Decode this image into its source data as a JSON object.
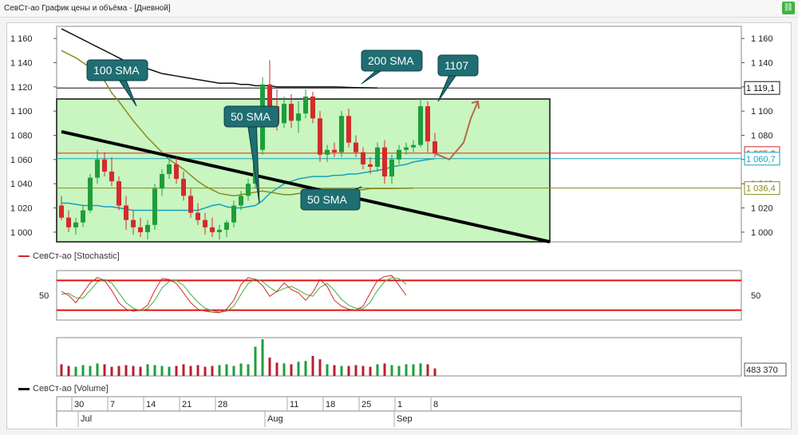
{
  "window": {
    "title": "СевСт-ао График цены и объёма - [Дневной]",
    "link_icon": "link-icon"
  },
  "colors": {
    "bull": "#1e9e3a",
    "bear": "#d42a2a",
    "sma50": "#15a0c0",
    "sma100": "#8a8a1a",
    "sma200": "#111111",
    "channel": "#c8f5c0",
    "callout": "#1f6e73",
    "stoch_k": "#d42a2a",
    "stoch_d": "#40b040",
    "stoch_level": "#e01010",
    "volume_up": "#1e9e3a",
    "volume_down": "#b81e2e"
  },
  "price_panel": {
    "y_ticks": [
      "1 160",
      "1 140",
      "1 120",
      "1 100",
      "1 080",
      "1 060",
      "1 040",
      "1 020",
      "1 000"
    ],
    "tags": [
      {
        "label": "1 119,1",
        "value": 1119.1,
        "color": "#111111"
      },
      {
        "label": "1 065,3",
        "value": 1065.3,
        "color": "#d42a2a"
      },
      {
        "label": "1 060,7",
        "value": 1060.7,
        "color": "#15a0c0"
      },
      {
        "label": "1 036,4",
        "value": 1036.4,
        "color": "#8a8a1a"
      }
    ],
    "callouts": [
      {
        "label": "100 SMA"
      },
      {
        "label": "50 SMA"
      },
      {
        "label": "200 SMA"
      },
      {
        "label": "1107"
      },
      {
        "label": "50 SMA"
      }
    ]
  },
  "stochastic": {
    "legend": "СевСт-ао [Stochastic]",
    "tick": "50",
    "upper": 80,
    "lower": 20
  },
  "volume": {
    "legend": "СевСт-ао [Volume]",
    "last_label": "483 370"
  },
  "time_axis": {
    "days": [
      {
        "label": "30",
        "idx": 2
      },
      {
        "label": "7",
        "idx": 7
      },
      {
        "label": "14",
        "idx": 12
      },
      {
        "label": "21",
        "idx": 17
      },
      {
        "label": "28",
        "idx": 22
      },
      {
        "label": "11",
        "idx": 32
      },
      {
        "label": "18",
        "idx": 37
      },
      {
        "label": "25",
        "idx": 42
      },
      {
        "label": "1",
        "idx": 47
      },
      {
        "label": "8",
        "idx": 52
      }
    ],
    "months": [
      {
        "label": "Jul",
        "idx": 3
      },
      {
        "label": "Aug",
        "idx": 29
      },
      {
        "label": "Sep",
        "idx": 47
      }
    ]
  },
  "chart_data": {
    "type": "candlestick",
    "ylim": [
      992,
      1170
    ],
    "candles": [
      [
        1022,
        1030,
        1010,
        1012
      ],
      [
        1012,
        1018,
        1000,
        1004
      ],
      [
        1004,
        1012,
        998,
        1008
      ],
      [
        1008,
        1022,
        1004,
        1018
      ],
      [
        1018,
        1048,
        1016,
        1045
      ],
      [
        1045,
        1068,
        1040,
        1060
      ],
      [
        1060,
        1066,
        1046,
        1050
      ],
      [
        1050,
        1062,
        1038,
        1042
      ],
      [
        1042,
        1046,
        1018,
        1022
      ],
      [
        1022,
        1030,
        1002,
        1010
      ],
      [
        1010,
        1018,
        998,
        1004
      ],
      [
        1004,
        1012,
        996,
        1000
      ],
      [
        1000,
        1010,
        994,
        1006
      ],
      [
        1006,
        1040,
        1002,
        1036
      ],
      [
        1036,
        1052,
        1030,
        1048
      ],
      [
        1048,
        1060,
        1044,
        1056
      ],
      [
        1056,
        1062,
        1040,
        1044
      ],
      [
        1044,
        1050,
        1026,
        1030
      ],
      [
        1030,
        1036,
        1012,
        1016
      ],
      [
        1016,
        1024,
        1006,
        1010
      ],
      [
        1010,
        1016,
        998,
        1004
      ],
      [
        1004,
        1012,
        996,
        1000
      ],
      [
        1000,
        1006,
        994,
        1002
      ],
      [
        1002,
        1010,
        996,
        1008
      ],
      [
        1008,
        1026,
        1004,
        1022
      ],
      [
        1022,
        1034,
        1018,
        1030
      ],
      [
        1030,
        1044,
        1026,
        1040
      ],
      [
        1040,
        1072,
        1036,
        1068
      ],
      [
        1068,
        1128,
        1064,
        1122
      ],
      [
        1122,
        1142,
        1096,
        1104
      ],
      [
        1104,
        1118,
        1084,
        1090
      ],
      [
        1090,
        1112,
        1086,
        1106
      ],
      [
        1106,
        1114,
        1086,
        1092
      ],
      [
        1092,
        1108,
        1082,
        1098
      ],
      [
        1098,
        1118,
        1094,
        1112
      ],
      [
        1112,
        1116,
        1090,
        1094
      ],
      [
        1094,
        1100,
        1058,
        1064
      ],
      [
        1064,
        1072,
        1058,
        1068
      ],
      [
        1068,
        1074,
        1062,
        1066
      ],
      [
        1066,
        1100,
        1062,
        1096
      ],
      [
        1096,
        1102,
        1070,
        1074
      ],
      [
        1074,
        1080,
        1062,
        1066
      ],
      [
        1066,
        1070,
        1052,
        1056
      ],
      [
        1056,
        1062,
        1048,
        1054
      ],
      [
        1054,
        1074,
        1050,
        1070
      ],
      [
        1070,
        1076,
        1040,
        1046
      ],
      [
        1046,
        1064,
        1040,
        1060
      ],
      [
        1060,
        1072,
        1056,
        1068
      ],
      [
        1068,
        1074,
        1064,
        1070
      ],
      [
        1070,
        1076,
        1066,
        1072
      ],
      [
        1072,
        1110,
        1070,
        1104
      ],
      [
        1104,
        1108,
        1066,
        1075
      ],
      [
        1075,
        1082,
        1062,
        1065
      ]
    ],
    "sma50": [
      1024,
      1024,
      1023,
      1022,
      1022,
      1022,
      1021,
      1021,
      1020,
      1019,
      1018,
      1018,
      1018,
      1018,
      1018,
      1018,
      1018,
      1018,
      1018,
      1018,
      1020,
      1022,
      1023,
      1021,
      1020,
      1020,
      1021,
      1022,
      1026,
      1032,
      1036,
      1040,
      1042,
      1044,
      1045,
      1046,
      1046,
      1046,
      1047,
      1047,
      1048,
      1048,
      1049,
      1050,
      1051,
      1052,
      1054,
      1055,
      1056,
      1058,
      1059,
      1060,
      1060.7
    ],
    "sma100": [
      1150,
      1147,
      1144,
      1140,
      1136,
      1132,
      1125,
      1115,
      1108,
      1100,
      1092,
      1085,
      1078,
      1072,
      1066,
      1060,
      1056,
      1052,
      1047,
      1042,
      1038,
      1035,
      1032,
      1031,
      1030,
      1031,
      1032,
      1033,
      1034,
      1033,
      1032,
      1031,
      1031,
      1032,
      1032,
      1033,
      1033,
      1034,
      1034,
      1034,
      1035,
      1035,
      1035,
      1036,
      1036,
      1036,
      1036,
      1036.2,
      1036.3,
      1036.4
    ],
    "sma200": [
      1168,
      1165,
      1162,
      1159,
      1156,
      1153,
      1150,
      1147,
      1144,
      1141,
      1139,
      1137,
      1135,
      1133,
      1131,
      1130,
      1129,
      1128,
      1127,
      1126,
      1125,
      1124,
      1123,
      1123,
      1123,
      1122,
      1122,
      1121,
      1121,
      1121,
      1120,
      1120,
      1120,
      1120,
      1120,
      1120,
      1120,
      1120,
      1120,
      1119.8,
      1119.6,
      1119.4,
      1119.3,
      1119.2,
      1119.1
    ],
    "trendline": [
      [
        0,
        1083
      ],
      [
        68,
        992
      ]
    ],
    "channel": {
      "x_end": 68,
      "top": 1110,
      "bottom": 990
    },
    "projection_arrow": [
      [
        52,
        1065
      ],
      [
        54,
        1060
      ],
      [
        56,
        1074
      ],
      [
        57,
        1094
      ],
      [
        58,
        1108
      ]
    ],
    "stoch_k": [
      58,
      50,
      35,
      55,
      75,
      86,
      80,
      60,
      35,
      22,
      18,
      20,
      30,
      60,
      84,
      82,
      74,
      55,
      35,
      22,
      18,
      16,
      15,
      22,
      40,
      72,
      86,
      82,
      70,
      48,
      58,
      75,
      62,
      55,
      40,
      56,
      82,
      68,
      40,
      28,
      22,
      20,
      28,
      55,
      80,
      88,
      90,
      70,
      50
    ],
    "stoch_d": [
      52,
      54,
      45,
      44,
      60,
      77,
      82,
      75,
      55,
      35,
      24,
      19,
      23,
      40,
      65,
      78,
      80,
      70,
      52,
      36,
      24,
      19,
      16,
      18,
      28,
      52,
      74,
      83,
      78,
      66,
      57,
      64,
      68,
      61,
      52,
      48,
      66,
      74,
      60,
      42,
      30,
      24,
      23,
      36,
      60,
      78,
      86,
      84,
      72
    ],
    "volume": [
      14,
      12,
      11,
      13,
      12,
      15,
      14,
      11,
      12,
      13,
      12,
      11,
      14,
      13,
      12,
      11,
      12,
      14,
      12,
      13,
      11,
      12,
      13,
      14,
      12,
      15,
      14,
      35,
      44,
      22,
      16,
      15,
      14,
      17,
      18,
      24,
      20,
      14,
      13,
      12,
      12,
      13,
      12,
      11,
      14,
      15,
      13,
      12,
      14,
      14,
      15,
      14,
      9
    ],
    "volume_last": 483370
  }
}
